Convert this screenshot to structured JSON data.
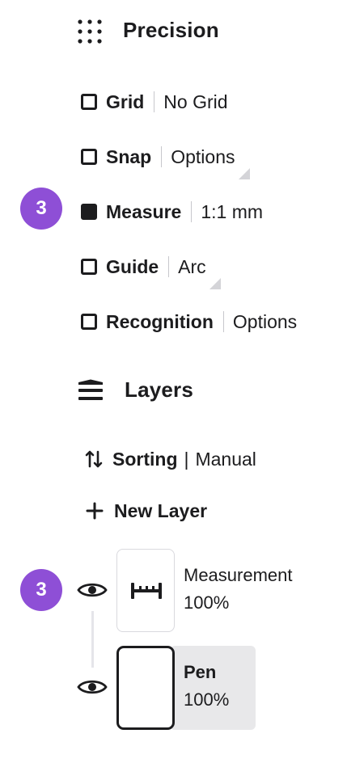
{
  "precision": {
    "title": "Precision",
    "rows": [
      {
        "label": "Grid",
        "value": "No Grid",
        "checked": false
      },
      {
        "label": "Snap",
        "value": "Options",
        "checked": false
      },
      {
        "label": "Measure",
        "value": "1:1 mm",
        "checked": true
      },
      {
        "label": "Guide",
        "value": "Arc",
        "checked": false
      },
      {
        "label": "Recognition",
        "value": "Options",
        "checked": false
      }
    ],
    "badge": "3"
  },
  "layers": {
    "title": "Layers",
    "sorting_label": "Sorting",
    "sorting_sep": "|",
    "sorting_value": "Manual",
    "new_layer_label": "New Layer",
    "badge": "3",
    "items": [
      {
        "name": "Measurement",
        "opacity": "100%",
        "visible": true,
        "selected": false
      },
      {
        "name": "Pen",
        "opacity": "100%",
        "visible": true,
        "selected": true
      }
    ]
  },
  "icons": {
    "precision": "dot-grid-icon",
    "layers": "layers-stack-icon",
    "sorting": "sort-arrows-icon",
    "new_layer": "plus-icon",
    "visibility": "eye-icon",
    "measurement_thumb": "ruler-measure-icon"
  },
  "colors": {
    "badge": "#8e4fd6",
    "text": "#1c1c1e",
    "selected_bg": "#e8e8ea"
  }
}
